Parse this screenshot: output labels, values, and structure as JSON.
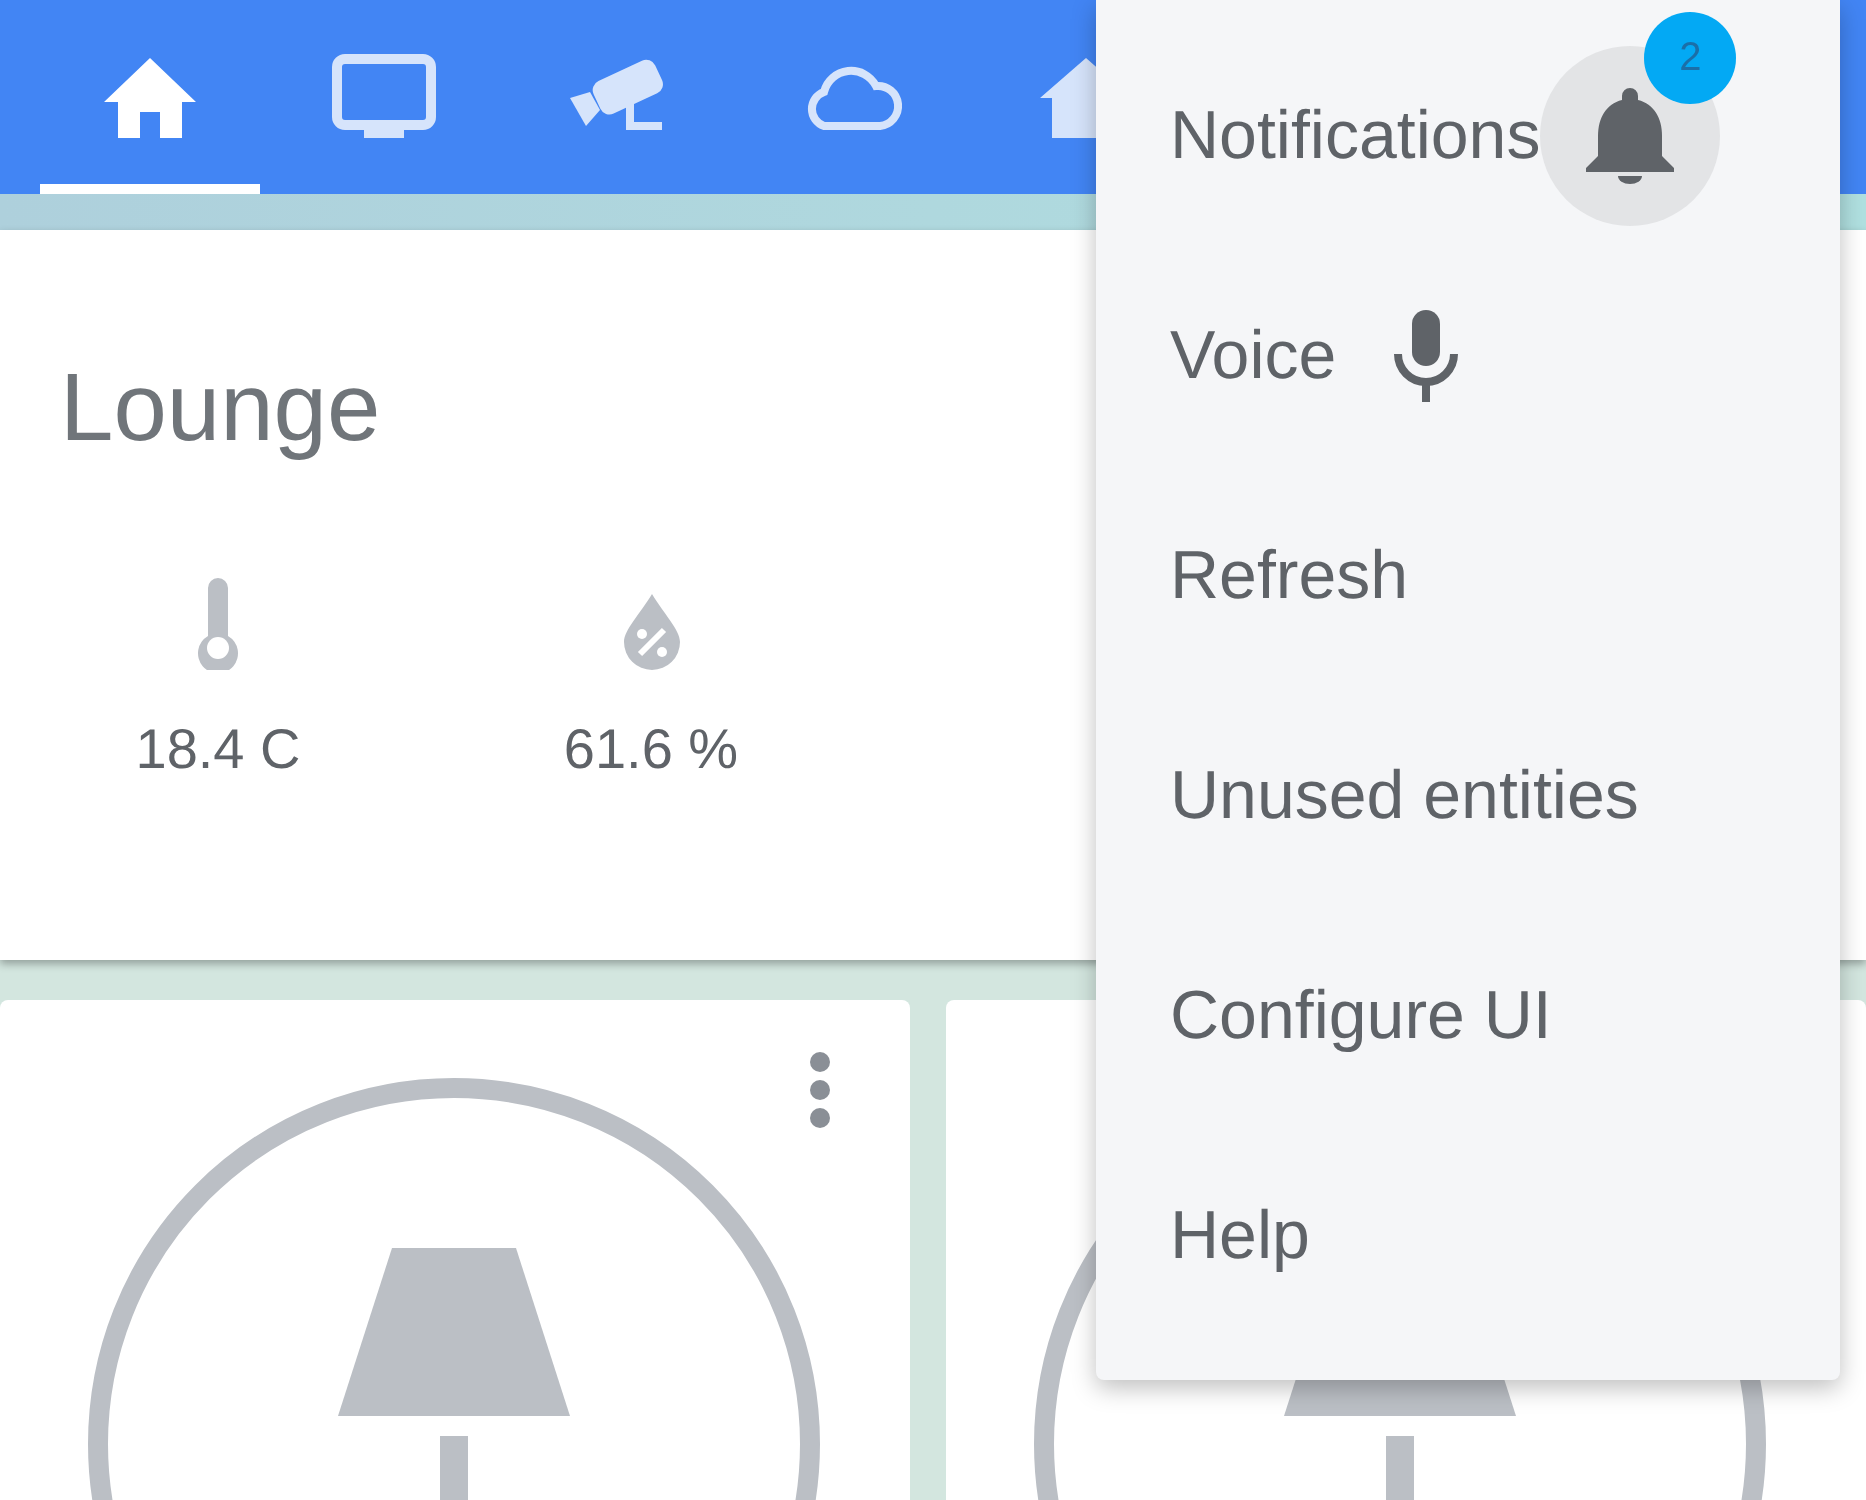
{
  "top_bar": {
    "tabs": [
      {
        "kind": "home",
        "selected": true
      },
      {
        "kind": "monitor",
        "selected": false
      },
      {
        "kind": "camera",
        "selected": false
      },
      {
        "kind": "cloud",
        "selected": false
      },
      {
        "kind": "wifi-home",
        "selected": false
      }
    ]
  },
  "area_card": {
    "title": "Lounge",
    "sensors": [
      {
        "kind": "temperature",
        "value": "18.4 C"
      },
      {
        "kind": "humidity",
        "value": "61.6 %"
      }
    ]
  },
  "light_cards": [
    {
      "kind": "lamp",
      "more_options": true
    },
    {
      "kind": "lamp"
    }
  ],
  "menu": {
    "items": [
      {
        "label": "Notifications",
        "kind": "notifications",
        "badge": "2"
      },
      {
        "label": "Voice",
        "kind": "voice"
      },
      {
        "label": "Refresh",
        "kind": "plain"
      },
      {
        "label": "Unused entities",
        "kind": "plain"
      },
      {
        "label": "Configure UI",
        "kind": "plain"
      },
      {
        "label": "Help",
        "kind": "plain"
      }
    ]
  }
}
